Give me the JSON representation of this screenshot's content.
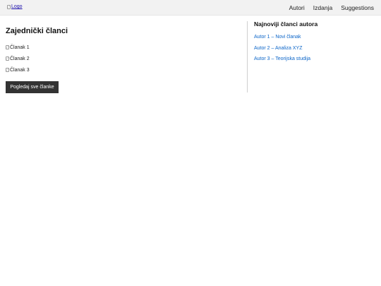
{
  "header": {
    "logo_alt": "Logo",
    "nav": [
      {
        "label": "Autori"
      },
      {
        "label": "Izdanja"
      },
      {
        "label": "Suggestions"
      }
    ]
  },
  "main": {
    "title": "Zajednički članci",
    "articles": [
      {
        "alt": "Članak 1"
      },
      {
        "alt": "Članak 2"
      },
      {
        "alt": "Članak 3"
      }
    ],
    "view_all_label": "Pogledaj sve članke"
  },
  "sidebar": {
    "title": "Najnoviji članci autora",
    "links": [
      {
        "label": "Autor 1 – Novi članak"
      },
      {
        "label": "Autor 2 – Analiza XYZ"
      },
      {
        "label": "Autor 3 – Teorijska studija"
      }
    ]
  },
  "colors": {
    "header_bg": "#f2f2f2",
    "button_bg": "#333333",
    "link": "#0a64c8"
  },
  "icons": {
    "broken_image": "broken-image-icon"
  }
}
